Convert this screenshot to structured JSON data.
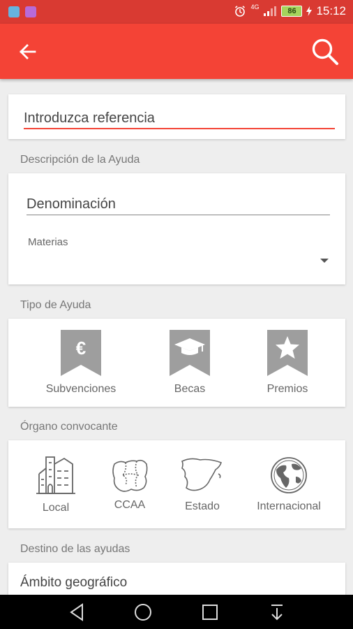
{
  "status_bar": {
    "battery": "86",
    "network": "4G",
    "time": "15:12"
  },
  "app_bar": {
    "back_icon": "arrow-left-icon",
    "search_icon": "search-icon"
  },
  "reference": {
    "placeholder": "Introduzca referencia"
  },
  "description_section": {
    "title": "Descripción de la Ayuda",
    "denominacion_placeholder": "Denominación",
    "materias_label": "Materias",
    "materias_value": ""
  },
  "tipo_section": {
    "title": "Tipo de Ayuda",
    "options": [
      {
        "label": "Subvenciones",
        "icon": "euro-bookmark-icon"
      },
      {
        "label": "Becas",
        "icon": "graduation-cap-bookmark-icon"
      },
      {
        "label": "Premios",
        "icon": "star-bookmark-icon"
      }
    ]
  },
  "organo_section": {
    "title": "Órgano convocante",
    "options": [
      {
        "label": "Local",
        "icon": "buildings-icon"
      },
      {
        "label": "CCAA",
        "icon": "regions-map-icon"
      },
      {
        "label": "Estado",
        "icon": "spain-map-icon"
      },
      {
        "label": "Internacional",
        "icon": "globe-icon"
      }
    ]
  },
  "destino_section": {
    "title": "Destino de las ayudas",
    "ambito_label": "Ámbito geográfico"
  },
  "colors": {
    "primary": "#f44336",
    "status_bar": "#d93a32",
    "icon_gray": "#9e9e9e"
  }
}
